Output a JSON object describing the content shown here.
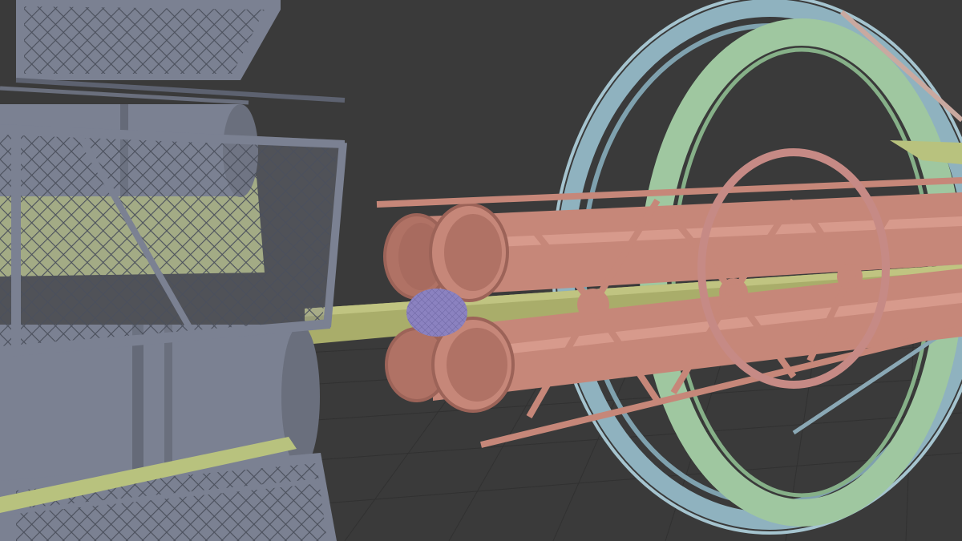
{
  "viewport": {
    "mode": "solid-shading-random-object-colors",
    "background_color": "#3a3a3a",
    "grid_line_color": "#2f2f2f",
    "grid_floor": true
  },
  "palette": {
    "gray_structure": "#7b8192",
    "gray_dark": "#565b68",
    "yellow_green": "#b8c27e",
    "salmon": "#c68779",
    "salmon_dark": "#9c6358",
    "teal_ring": "#8fb2bf",
    "mint_ring": "#9fc7a0",
    "purple_mesh": "#8b82c0",
    "olive_rod": "#a9ad6a",
    "pink_ring": "#c68a85"
  },
  "objects": [
    {
      "name": "mesh-cage-structure",
      "color_key": "gray_structure"
    },
    {
      "name": "fuel-tank-cylinders",
      "color_key": "gray_structure"
    },
    {
      "name": "yellow-panel",
      "color_key": "yellow_green"
    },
    {
      "name": "central-rod",
      "color_key": "olive_rod"
    },
    {
      "name": "rocket-tube-cluster",
      "color_key": "salmon"
    },
    {
      "name": "truss-frame",
      "color_key": "salmon"
    },
    {
      "name": "outer-ring",
      "color_key": "teal_ring"
    },
    {
      "name": "inner-ring",
      "color_key": "mint_ring"
    },
    {
      "name": "steering-ring",
      "color_key": "pink_ring"
    },
    {
      "name": "nozzle-mesh",
      "color_key": "purple_mesh"
    }
  ]
}
